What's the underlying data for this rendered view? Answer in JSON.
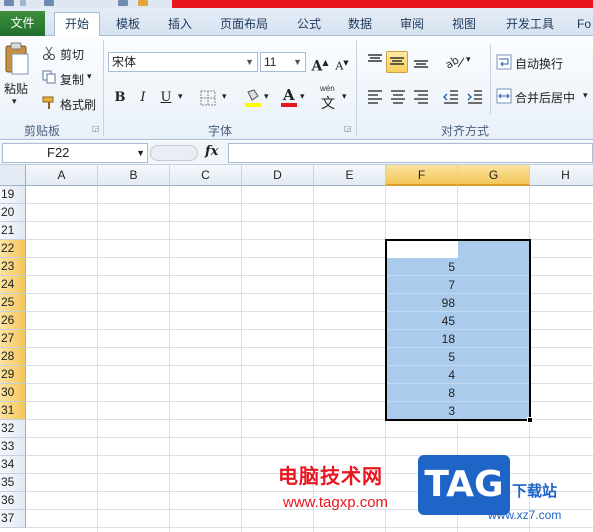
{
  "tabs": {
    "file": "文件",
    "home": "开始",
    "template": "模板",
    "insert": "插入",
    "layout": "页面布局",
    "formula": "公式",
    "data": "数据",
    "review": "审阅",
    "view": "视图",
    "developer": "开发工具",
    "more": "Fo"
  },
  "clipboard": {
    "paste": "粘贴",
    "cut": "剪切",
    "copy": "复制",
    "format_painter": "格式刷",
    "label": "剪贴板"
  },
  "font": {
    "name": "宋体",
    "size": "11",
    "label": "字体",
    "bold": "B",
    "italic": "I",
    "underline": "U",
    "grow": "A",
    "shrink": "A",
    "font_color_glyph": "A",
    "phonetic": "wén"
  },
  "alignment": {
    "wrap_text": "自动换行",
    "merge_center": "合并后居中",
    "label": "对齐方式"
  },
  "formula_bar": {
    "name_box": "F22",
    "fx": "fx",
    "value": ""
  },
  "columns": [
    "A",
    "B",
    "C",
    "D",
    "E",
    "F",
    "G",
    "H"
  ],
  "rows": [
    "19",
    "20",
    "21",
    "22",
    "23",
    "24",
    "25",
    "26",
    "27",
    "28",
    "29",
    "30",
    "31",
    "32",
    "33",
    "34",
    "35",
    "36",
    "37"
  ],
  "cells_f": [
    "5",
    "7",
    "98",
    "45",
    "18",
    "5",
    "4",
    "8",
    "3"
  ],
  "watermark": {
    "cn": "电脑技术网",
    "url": "www.tagxp.com",
    "tag": "TAG",
    "download": "下载站",
    "url2": "www.xz7.com"
  },
  "colors": {
    "selection": "#aacbec",
    "header_selected": "#f4c65a",
    "file_tab": "#2a7d34",
    "accent_red": "#e8161f"
  }
}
